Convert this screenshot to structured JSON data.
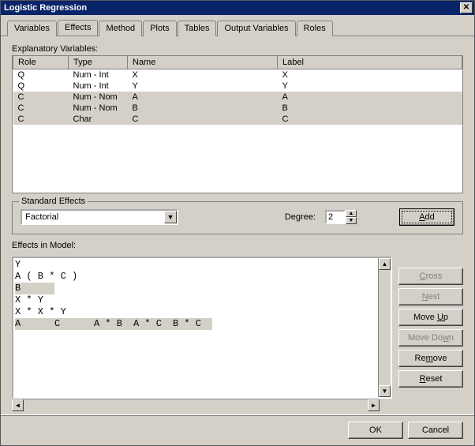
{
  "window": {
    "title": "Logistic Regression"
  },
  "tabs": [
    {
      "label": "Variables"
    },
    {
      "label": "Effects"
    },
    {
      "label": "Method"
    },
    {
      "label": "Plots"
    },
    {
      "label": "Tables"
    },
    {
      "label": "Output Variables"
    },
    {
      "label": "Roles"
    }
  ],
  "active_tab": 1,
  "explanatory": {
    "label": "Explanatory Variables:",
    "columns": [
      "Role",
      "Type",
      "Name",
      "Label"
    ],
    "rows": [
      {
        "role": "Q",
        "type": "Num - Int",
        "name": "X",
        "label": "X",
        "selected": false
      },
      {
        "role": "Q",
        "type": "Num - Int",
        "name": "Y",
        "label": "Y",
        "selected": false
      },
      {
        "role": "C",
        "type": "Num - Nom",
        "name": "A",
        "label": "A",
        "selected": true
      },
      {
        "role": "C",
        "type": "Num - Nom",
        "name": "B",
        "label": "B",
        "selected": true
      },
      {
        "role": "C",
        "type": "Char",
        "name": "C",
        "label": "C",
        "selected": true
      }
    ]
  },
  "standard_effects": {
    "legend": "Standard Effects",
    "combo_value": "Factorial",
    "degree_label": "Degree:",
    "degree_value": "2",
    "add_label": "Add"
  },
  "effects_in_model": {
    "label": "Effects in Model:",
    "items": [
      {
        "text": "Y",
        "selected": false
      },
      {
        "text": "A ( B * C )",
        "selected": false
      },
      {
        "text": "B",
        "selected": true
      },
      {
        "text": "X * Y",
        "selected": false
      },
      {
        "text": "X * X * Y",
        "selected": false
      },
      {
        "text": "A",
        "selected": true
      },
      {
        "text": "C",
        "selected": true
      },
      {
        "text": "A * B",
        "selected": true
      },
      {
        "text": "A * C",
        "selected": true
      },
      {
        "text": "B * C",
        "selected": true
      }
    ]
  },
  "side_buttons": {
    "cross": "Cross",
    "nest": "Nest",
    "moveup": "Move Up",
    "movedown": "Move Down",
    "remove": "Remove",
    "reset": "Reset"
  },
  "footer": {
    "ok": "OK",
    "cancel": "Cancel"
  }
}
